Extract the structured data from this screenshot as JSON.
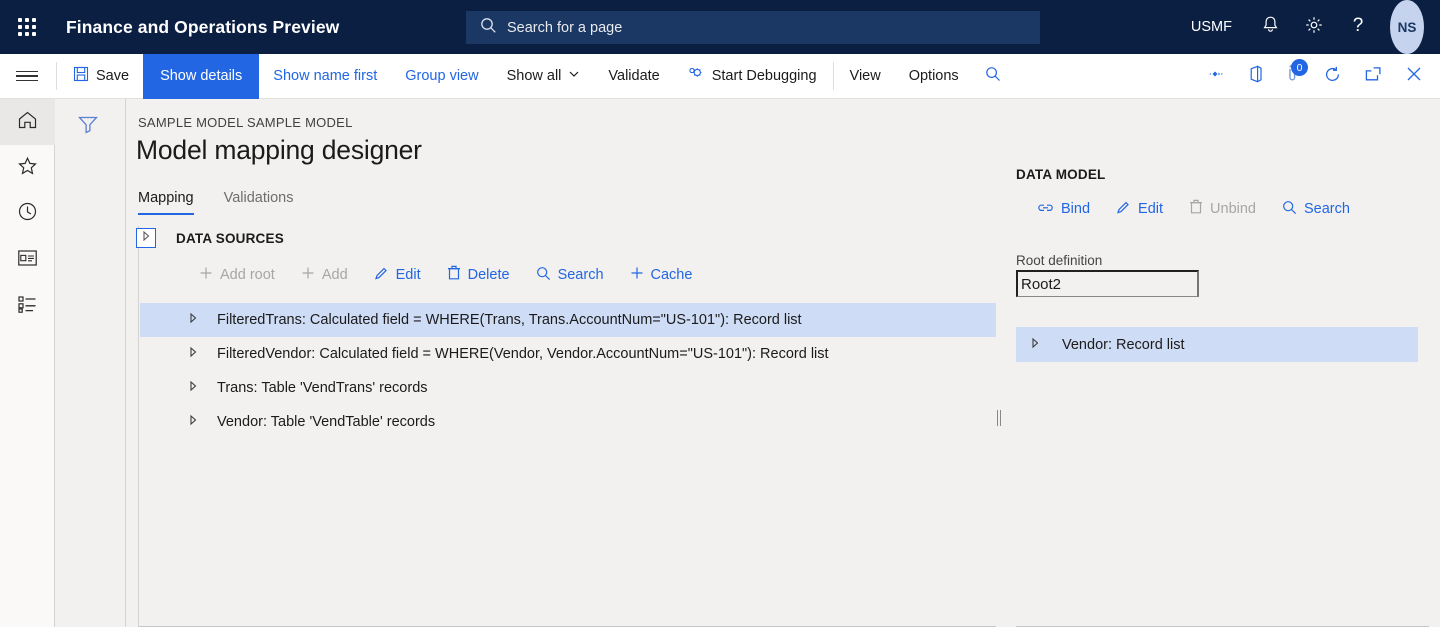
{
  "topnav": {
    "waffle_label": "app-launcher",
    "app_title": "Finance and Operations Preview",
    "search_placeholder": "Search for a page",
    "company": "USMF",
    "notifications_label": "Notifications",
    "settings_label": "Settings",
    "help_label": "Help",
    "avatar_initials": "NS"
  },
  "commandbar": {
    "save": "Save",
    "show_details": "Show details",
    "show_name_first": "Show name first",
    "group_view": "Group view",
    "show_all": "Show all",
    "validate": "Validate",
    "start_debugging": "Start Debugging",
    "view": "View",
    "options": "Options",
    "search_label": "Search",
    "attachments_label": "Attachments",
    "office_label": "Open in Microsoft Office",
    "notes_badge": "0",
    "notes_label": "Notes",
    "refresh_label": "Refresh",
    "popout_label": "Open in new window",
    "close_label": "Close"
  },
  "rail": {
    "items": [
      {
        "name": "home",
        "label": "Home",
        "selected": true
      },
      {
        "name": "favorites",
        "label": "Favorites",
        "selected": false
      },
      {
        "name": "recent",
        "label": "Recent",
        "selected": false
      },
      {
        "name": "workspaces",
        "label": "Workspaces",
        "selected": false
      },
      {
        "name": "modules",
        "label": "Modules",
        "selected": false
      }
    ]
  },
  "filter": {
    "label": "Filter"
  },
  "page": {
    "breadcrumb": "SAMPLE MODEL SAMPLE MODEL",
    "title": "Model mapping designer",
    "tabs": [
      {
        "label": "Mapping",
        "selected": true
      },
      {
        "label": "Validations",
        "selected": false
      }
    ]
  },
  "data_sources": {
    "heading": "DATA SOURCES",
    "expander_label": "Expand panel",
    "tools": [
      {
        "label": "Add root",
        "icon": "plus-icon",
        "disabled": true
      },
      {
        "label": "Add",
        "icon": "plus-icon",
        "disabled": true
      },
      {
        "label": "Edit",
        "icon": "pencil-icon",
        "disabled": false
      },
      {
        "label": "Delete",
        "icon": "trash-icon",
        "disabled": false
      },
      {
        "label": "Search",
        "icon": "search-icon",
        "disabled": false
      },
      {
        "label": "Cache",
        "icon": "plus-icon",
        "disabled": false
      }
    ],
    "rows": [
      {
        "label": "FilteredTrans: Calculated field = WHERE(Trans, Trans.AccountNum=\"US-101\"): Record list",
        "selected": true
      },
      {
        "label": "FilteredVendor: Calculated field = WHERE(Vendor, Vendor.AccountNum=\"US-101\"): Record list",
        "selected": false
      },
      {
        "label": "Trans: Table 'VendTrans' records",
        "selected": false
      },
      {
        "label": "Vendor: Table 'VendTable' records",
        "selected": false
      }
    ]
  },
  "data_model": {
    "heading": "DATA MODEL",
    "tools": [
      {
        "label": "Bind",
        "icon": "link-icon",
        "disabled": false
      },
      {
        "label": "Edit",
        "icon": "pencil-icon",
        "disabled": false
      },
      {
        "label": "Unbind",
        "icon": "trash-icon",
        "disabled": true
      },
      {
        "label": "Search",
        "icon": "search-icon",
        "disabled": false
      }
    ],
    "root_definition_label": "Root definition",
    "root_definition_value": "Root2",
    "rows": [
      {
        "label": "Vendor: Record list",
        "selected": true
      }
    ]
  },
  "colors": {
    "brand_navy": "#0b1f42",
    "accent_blue": "#2266e3",
    "selection_blue": "#cfdcf5",
    "page_bg": "#f2f1f0",
    "disabled_gray": "#a8a6a4"
  }
}
